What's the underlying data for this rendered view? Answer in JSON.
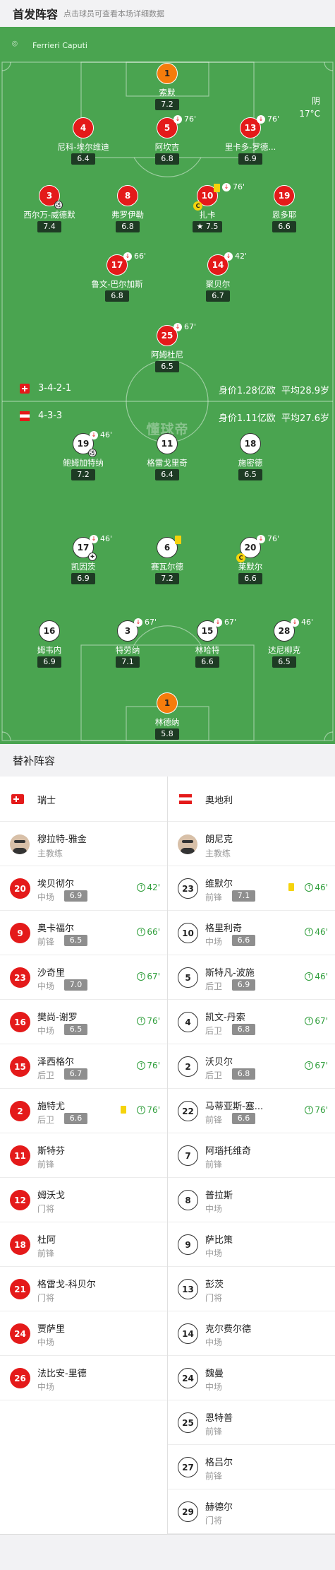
{
  "header": {
    "title": "首发阵容",
    "subtitle": "点击球员可查看本场详细数据"
  },
  "pitch": {
    "stadium_icon": "stadium-icon",
    "referee": "Ferrieri Caputi",
    "weather": "阴",
    "temperature": "17°C",
    "watermark": "懂球帝",
    "home": {
      "formation": "3-4-2-1",
      "value": "身价1.28亿欧",
      "avg_age": "平均28.9岁"
    },
    "away": {
      "formation": "4-3-3",
      "value": "身价1.11亿欧",
      "avg_age": "平均27.6岁"
    }
  },
  "home_players": [
    {
      "num": "1",
      "name": "索默",
      "rating": "7.2"
    },
    {
      "num": "4",
      "name": "尼科-埃尔维迪",
      "rating": "6.4"
    },
    {
      "num": "5",
      "name": "阿坎吉",
      "rating": "6.8",
      "sub": "76'"
    },
    {
      "num": "13",
      "name": "里卡多-罗德...",
      "rating": "6.9",
      "sub": "76'"
    },
    {
      "num": "3",
      "name": "西尔万-威德默",
      "rating": "7.4"
    },
    {
      "num": "8",
      "name": "弗罗伊勒",
      "rating": "6.8"
    },
    {
      "num": "10",
      "name": "扎卡",
      "rating": "7.5",
      "sub": "76'"
    },
    {
      "num": "19",
      "name": "恩多耶",
      "rating": "6.6"
    },
    {
      "num": "17",
      "name": "鲁文-巴尔加斯",
      "rating": "6.8",
      "sub": "66'"
    },
    {
      "num": "14",
      "name": "聚贝尔",
      "rating": "6.7",
      "sub": "42'"
    },
    {
      "num": "25",
      "name": "阿姆杜尼",
      "rating": "6.5",
      "sub": "67'"
    }
  ],
  "away_players": [
    {
      "num": "19",
      "name": "鲍姆加特纳",
      "rating": "7.2",
      "sub": "46'"
    },
    {
      "num": "11",
      "name": "格雷戈里奇",
      "rating": "6.4"
    },
    {
      "num": "18",
      "name": "施密德",
      "rating": "6.5"
    },
    {
      "num": "17",
      "name": "凯因茨",
      "rating": "6.9",
      "sub": "46'"
    },
    {
      "num": "6",
      "name": "赛瓦尔德",
      "rating": "7.2"
    },
    {
      "num": "20",
      "name": "莱默尔",
      "rating": "6.6",
      "sub": "76'"
    },
    {
      "num": "16",
      "name": "姆韦内",
      "rating": "6.9"
    },
    {
      "num": "3",
      "name": "特劳纳",
      "rating": "7.1",
      "sub": "67'"
    },
    {
      "num": "15",
      "name": "林哈特",
      "rating": "6.6",
      "sub": "67'"
    },
    {
      "num": "28",
      "name": "达尼柳克",
      "rating": "6.5",
      "sub": "46'"
    },
    {
      "num": "1",
      "name": "林德纳",
      "rating": "5.8"
    }
  ],
  "subs_title": "替补阵容",
  "home_team": {
    "name": "瑞士",
    "coach": "穆拉特-雅金",
    "coach_role": "主教练",
    "subs": [
      {
        "num": "20",
        "name": "埃贝彻尔",
        "pos": "中场",
        "rating": "6.9",
        "in": "42'"
      },
      {
        "num": "9",
        "name": "奥卡福尔",
        "pos": "前锋",
        "rating": "6.5",
        "in": "66'"
      },
      {
        "num": "23",
        "name": "沙奇里",
        "pos": "中场",
        "rating": "7.0",
        "in": "67'"
      },
      {
        "num": "16",
        "name": "樊尚-谢罗",
        "pos": "中场",
        "rating": "6.5",
        "in": "76'"
      },
      {
        "num": "15",
        "name": "泽西格尔",
        "pos": "后卫",
        "rating": "6.7",
        "in": "76'"
      },
      {
        "num": "2",
        "name": "施特尤",
        "pos": "后卫",
        "rating": "6.6",
        "in": "76'"
      },
      {
        "num": "11",
        "name": "斯特芬",
        "pos": "前锋"
      },
      {
        "num": "12",
        "name": "姆沃戈",
        "pos": "门将"
      },
      {
        "num": "18",
        "name": "杜阿",
        "pos": "前锋"
      },
      {
        "num": "21",
        "name": "格雷戈-科贝尔",
        "pos": "门将"
      },
      {
        "num": "24",
        "name": "贾萨里",
        "pos": "中场"
      },
      {
        "num": "26",
        "name": "法比安-里德",
        "pos": "中场"
      }
    ]
  },
  "away_team": {
    "name": "奥地利",
    "coach": "朗尼克",
    "coach_role": "主教练",
    "subs": [
      {
        "num": "23",
        "name": "维默尔",
        "pos": "前锋",
        "rating": "7.1",
        "in": "46'"
      },
      {
        "num": "10",
        "name": "格里利奇",
        "pos": "中场",
        "rating": "6.6",
        "in": "46'"
      },
      {
        "num": "5",
        "name": "斯特凡-波施",
        "pos": "后卫",
        "rating": "6.9",
        "in": "46'"
      },
      {
        "num": "4",
        "name": "凯文-丹索",
        "pos": "后卫",
        "rating": "6.8",
        "in": "67'"
      },
      {
        "num": "2",
        "name": "沃贝尔",
        "pos": "后卫",
        "rating": "6.8",
        "in": "67'"
      },
      {
        "num": "22",
        "name": "马蒂亚斯-塞...",
        "pos": "前锋",
        "rating": "6.6",
        "in": "76'"
      },
      {
        "num": "7",
        "name": "阿瑙托维奇",
        "pos": "前锋"
      },
      {
        "num": "8",
        "name": "普拉斯",
        "pos": "中场"
      },
      {
        "num": "9",
        "name": "萨比策",
        "pos": "中场"
      },
      {
        "num": "13",
        "name": "彭茨",
        "pos": "门将"
      },
      {
        "num": "14",
        "name": "克尔费尔德",
        "pos": "中场"
      },
      {
        "num": "24",
        "name": "魏曼",
        "pos": "中场"
      },
      {
        "num": "25",
        "name": "恩特普",
        "pos": "前锋"
      },
      {
        "num": "27",
        "name": "格吕尔",
        "pos": "前锋"
      },
      {
        "num": "29",
        "name": "赫德尔",
        "pos": "门将"
      }
    ]
  }
}
